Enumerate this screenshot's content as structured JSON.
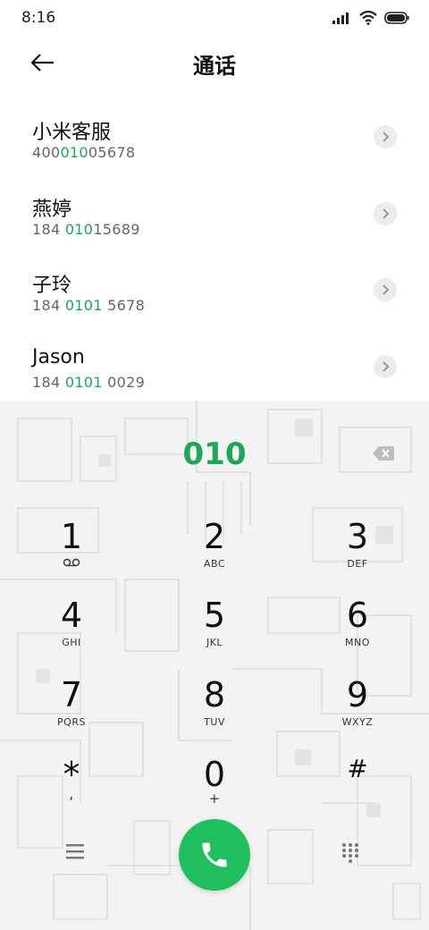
{
  "status": {
    "time": "8:16"
  },
  "header": {
    "title": "通话"
  },
  "contacts": [
    {
      "name": "小米客服",
      "num_pre": "400",
      "num_hl": "010",
      "num_post": "05678"
    },
    {
      "name": "燕婷",
      "num_pre": "184 ",
      "num_hl": "010",
      "num_post": "15689"
    },
    {
      "name": "子玲",
      "num_pre": "184 ",
      "num_hl": "0101",
      "num_post": " 5678"
    },
    {
      "name": "Jason",
      "num_pre": "184 ",
      "num_hl": "0101",
      "num_post": " 0029"
    }
  ],
  "dialer": {
    "input": "010",
    "keys": [
      {
        "digit": "1",
        "letters": ""
      },
      {
        "digit": "2",
        "letters": "ABC"
      },
      {
        "digit": "3",
        "letters": "DEF"
      },
      {
        "digit": "4",
        "letters": "GHI"
      },
      {
        "digit": "5",
        "letters": "JKL"
      },
      {
        "digit": "6",
        "letters": "MNO"
      },
      {
        "digit": "7",
        "letters": "PQRS"
      },
      {
        "digit": "8",
        "letters": "TUV"
      },
      {
        "digit": "9",
        "letters": "WXYZ"
      },
      {
        "digit": "*",
        "letters": ","
      },
      {
        "digit": "0",
        "letters": "+"
      },
      {
        "digit": "#",
        "letters": ""
      }
    ]
  },
  "colors": {
    "accent": "#1aa857",
    "call": "#1fbf5d"
  }
}
